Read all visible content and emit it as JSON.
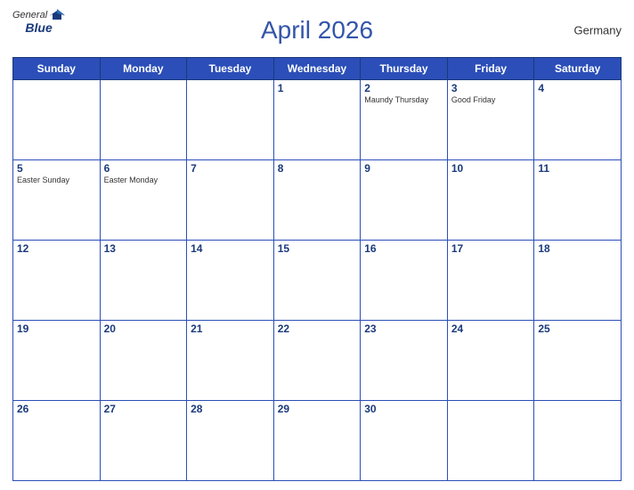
{
  "header": {
    "logo_general": "General",
    "logo_blue": "Blue",
    "title": "April 2026",
    "country": "Germany"
  },
  "days_of_week": [
    "Sunday",
    "Monday",
    "Tuesday",
    "Wednesday",
    "Thursday",
    "Friday",
    "Saturday"
  ],
  "weeks": [
    [
      {
        "day": "",
        "event": ""
      },
      {
        "day": "",
        "event": ""
      },
      {
        "day": "",
        "event": ""
      },
      {
        "day": "1",
        "event": ""
      },
      {
        "day": "2",
        "event": "Maundy Thursday"
      },
      {
        "day": "3",
        "event": "Good Friday"
      },
      {
        "day": "4",
        "event": ""
      }
    ],
    [
      {
        "day": "5",
        "event": "Easter Sunday"
      },
      {
        "day": "6",
        "event": "Easter Monday"
      },
      {
        "day": "7",
        "event": ""
      },
      {
        "day": "8",
        "event": ""
      },
      {
        "day": "9",
        "event": ""
      },
      {
        "day": "10",
        "event": ""
      },
      {
        "day": "11",
        "event": ""
      }
    ],
    [
      {
        "day": "12",
        "event": ""
      },
      {
        "day": "13",
        "event": ""
      },
      {
        "day": "14",
        "event": ""
      },
      {
        "day": "15",
        "event": ""
      },
      {
        "day": "16",
        "event": ""
      },
      {
        "day": "17",
        "event": ""
      },
      {
        "day": "18",
        "event": ""
      }
    ],
    [
      {
        "day": "19",
        "event": ""
      },
      {
        "day": "20",
        "event": ""
      },
      {
        "day": "21",
        "event": ""
      },
      {
        "day": "22",
        "event": ""
      },
      {
        "day": "23",
        "event": ""
      },
      {
        "day": "24",
        "event": ""
      },
      {
        "day": "25",
        "event": ""
      }
    ],
    [
      {
        "day": "26",
        "event": ""
      },
      {
        "day": "27",
        "event": ""
      },
      {
        "day": "28",
        "event": ""
      },
      {
        "day": "29",
        "event": ""
      },
      {
        "day": "30",
        "event": ""
      },
      {
        "day": "",
        "event": ""
      },
      {
        "day": "",
        "event": ""
      }
    ]
  ],
  "colors": {
    "header_bg": "#2b4eb8",
    "header_text": "#ffffff",
    "title_color": "#3355aa",
    "day_number_color": "#1a3a7c",
    "border_color": "#2b4eb8"
  }
}
